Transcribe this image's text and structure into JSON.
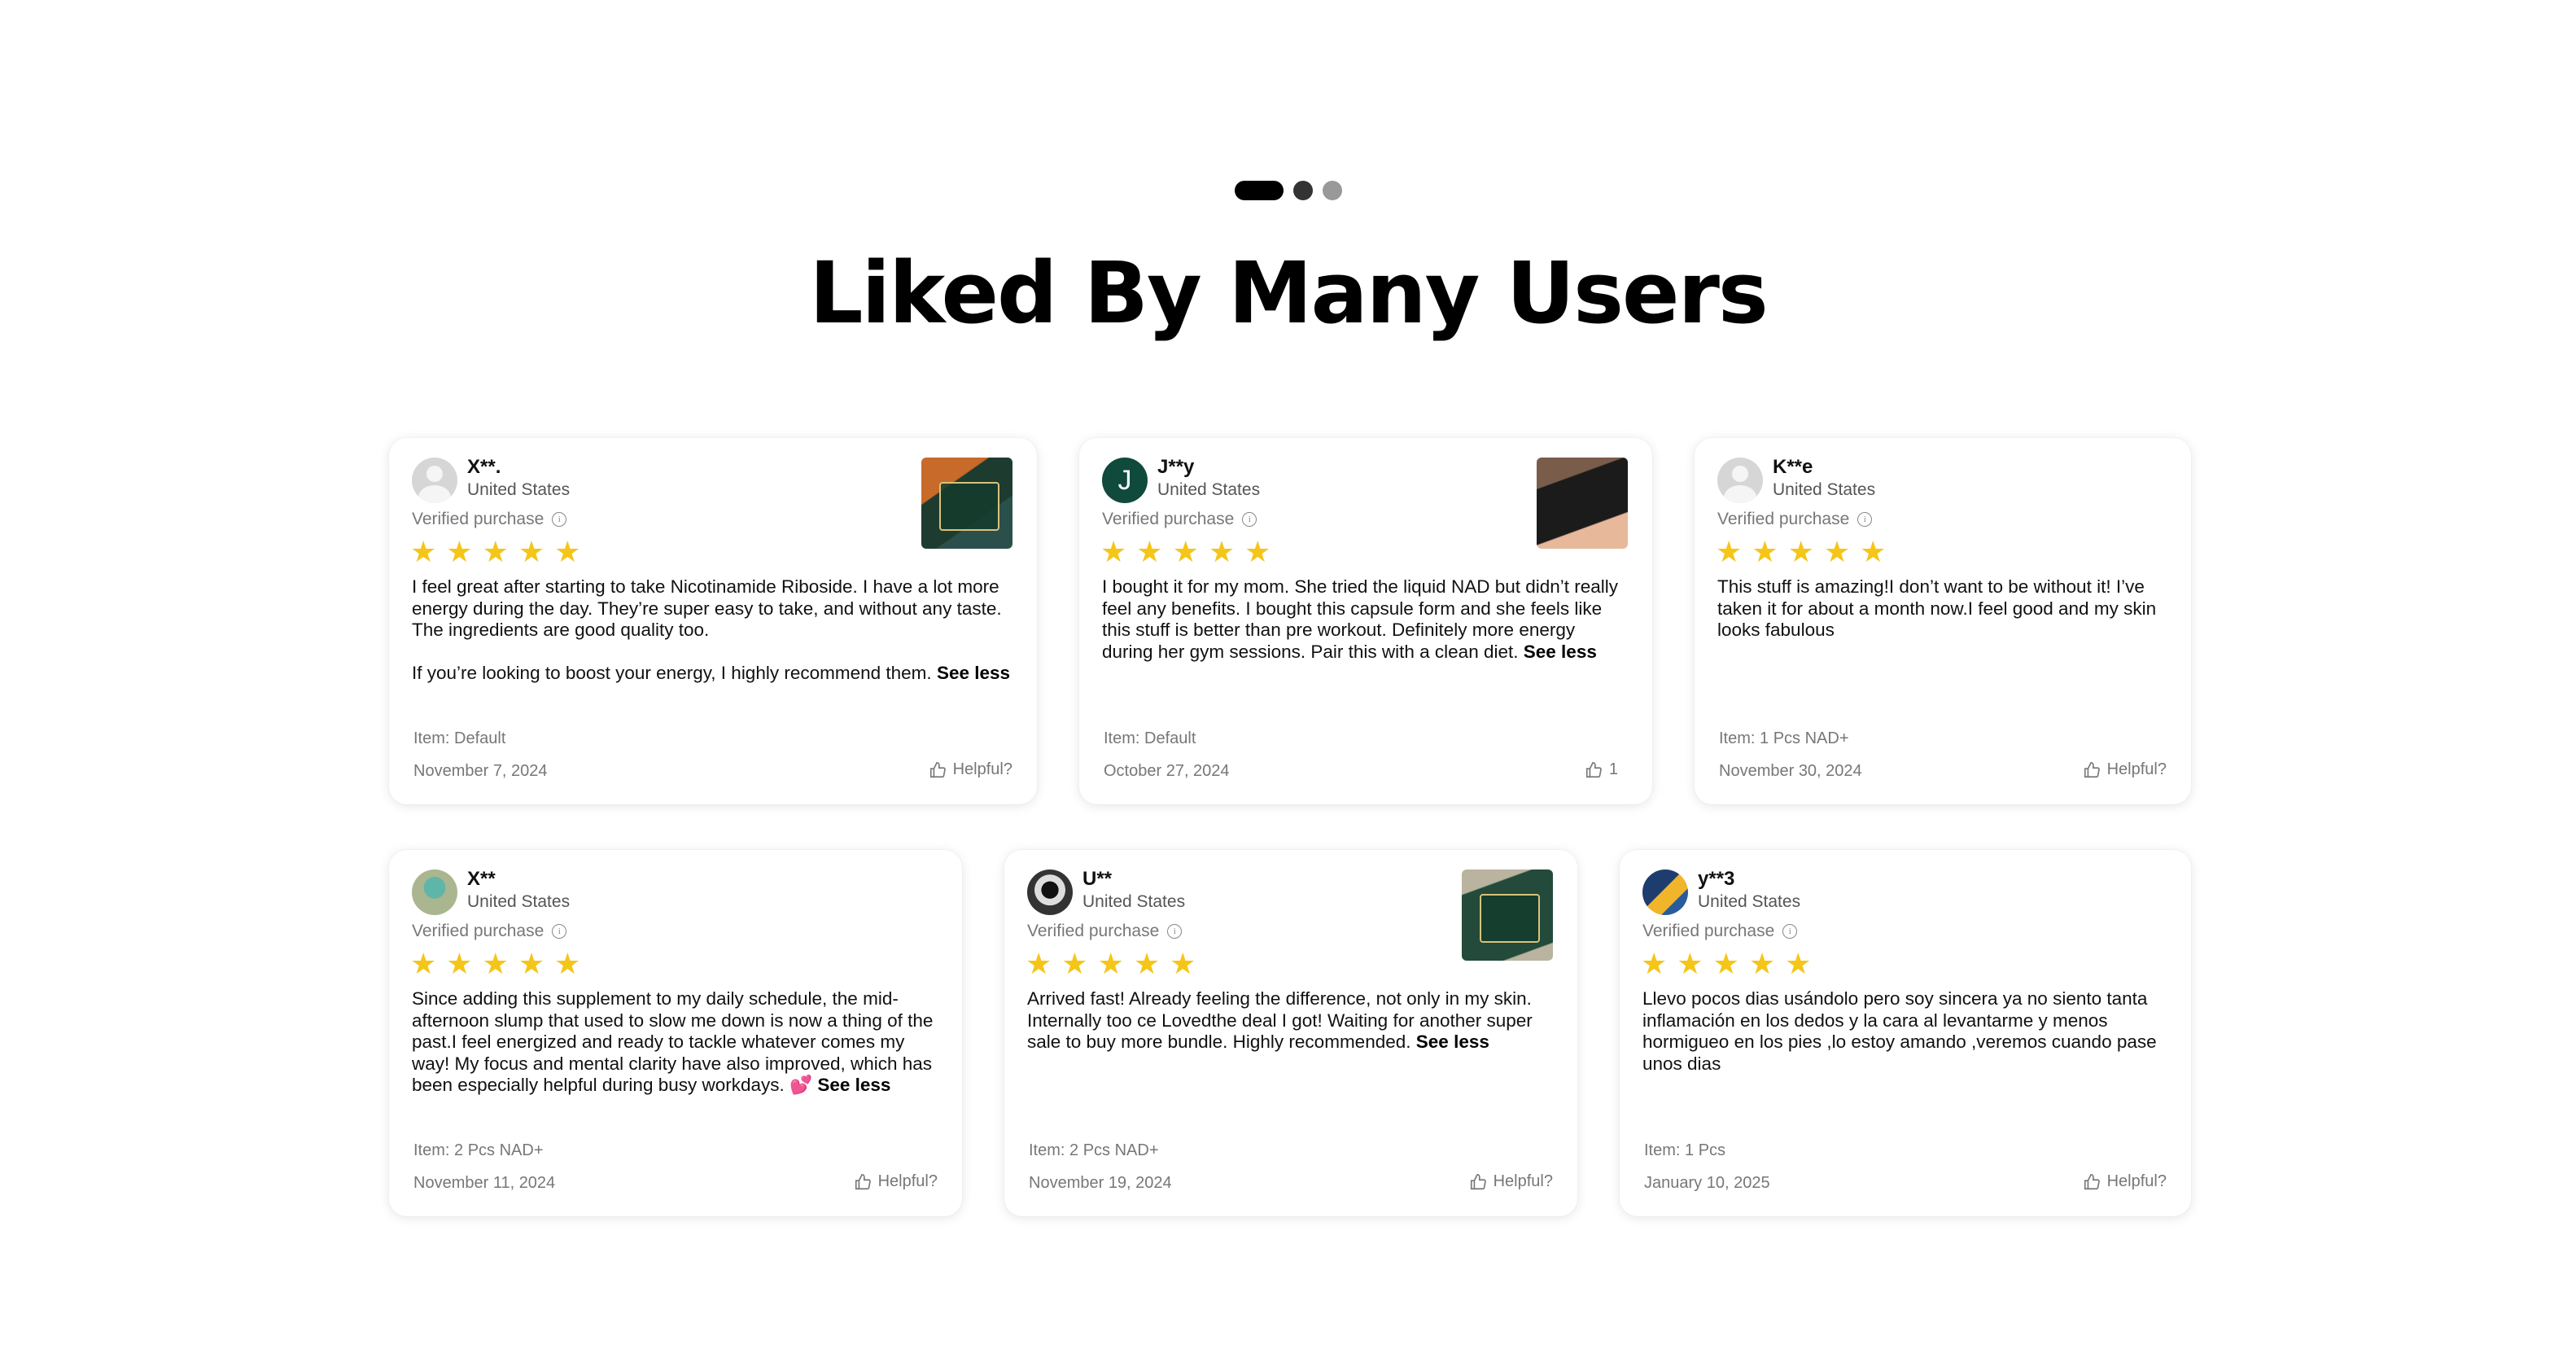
{
  "carousel": {
    "total": 3,
    "active_index": 0
  },
  "heading": "Liked By Many Users",
  "colors": {
    "star": "#f5c518",
    "avatar_j": "#0f4a3c"
  },
  "reviews": [
    {
      "user": "X**.",
      "country": "United States",
      "verified": "Verified purchase",
      "rating": 5,
      "paragraph1": "I feel great after starting to take Nicotinamide Riboside. I have a lot more energy during the day. They’re super easy to take, and without any taste. The ingredients are good quality too.",
      "paragraph2": "If you’re looking to boost your energy, I highly recommend them.",
      "see_less": "See less",
      "item": "Item: Default",
      "date": "November 7, 2024",
      "helpful": "Helpful?"
    },
    {
      "user": "J**y",
      "avatar_letter": "J",
      "country": "United States",
      "verified": "Verified purchase",
      "rating": 5,
      "text": "I bought it for my mom. She tried the liquid NAD but didn’t really feel any benefits. I bought this capsule form and she feels like this stuff is better than pre workout. Definitely more energy during her gym sessions. Pair this with a clean diet.",
      "see_less": "See less",
      "item": "Item: Default",
      "date": "October 27, 2024",
      "helpful": "1"
    },
    {
      "user": "K**e",
      "country": "United States",
      "verified": "Verified purchase",
      "rating": 5,
      "text": "This stuff is amazing!I don’t want to be without it! I’ve taken it for about a month now.I feel good and my skin looks fabulous",
      "item": "Item: 1 Pcs NAD+",
      "date": "November 30, 2024",
      "helpful": "Helpful?"
    },
    {
      "user": "X**",
      "country": "United States",
      "verified": "Verified purchase",
      "rating": 5,
      "text": "Since adding this supplement to my daily schedule, the mid-afternoon slump that used to slow me down is now a thing of the past.I feel energized and ready to tackle whatever comes my way! My focus and mental clarity have also improved, which has been especially helpful during busy workdays.",
      "emoji": "💕",
      "see_less": "See less",
      "item": "Item: 2 Pcs NAD+",
      "date": "November 11, 2024",
      "helpful": "Helpful?"
    },
    {
      "user": "U**",
      "country": "United States",
      "verified": "Verified purchase",
      "rating": 5,
      "text": "Arrived fast! Already feeling the difference, not only in my skin. Internally too ce Lovedthe deal I got! Waiting for another super sale to buy more bundle. Highly recommended.",
      "see_less": "See less",
      "item": "Item: 2 Pcs NAD+",
      "date": "November 19, 2024",
      "helpful": "Helpful?"
    },
    {
      "user": "y**3",
      "country": "United States",
      "verified": "Verified purchase",
      "rating": 5,
      "text": "Llevo pocos dias usándolo pero soy sincera ya no siento tanta inflamación en los dedos y la cara al levantarme y menos hormigueo en los pies ,lo estoy amando ,veremos cuando pase unos dias",
      "item": "Item: 1 Pcs",
      "date": "January 10, 2025",
      "helpful": "Helpful?"
    }
  ]
}
